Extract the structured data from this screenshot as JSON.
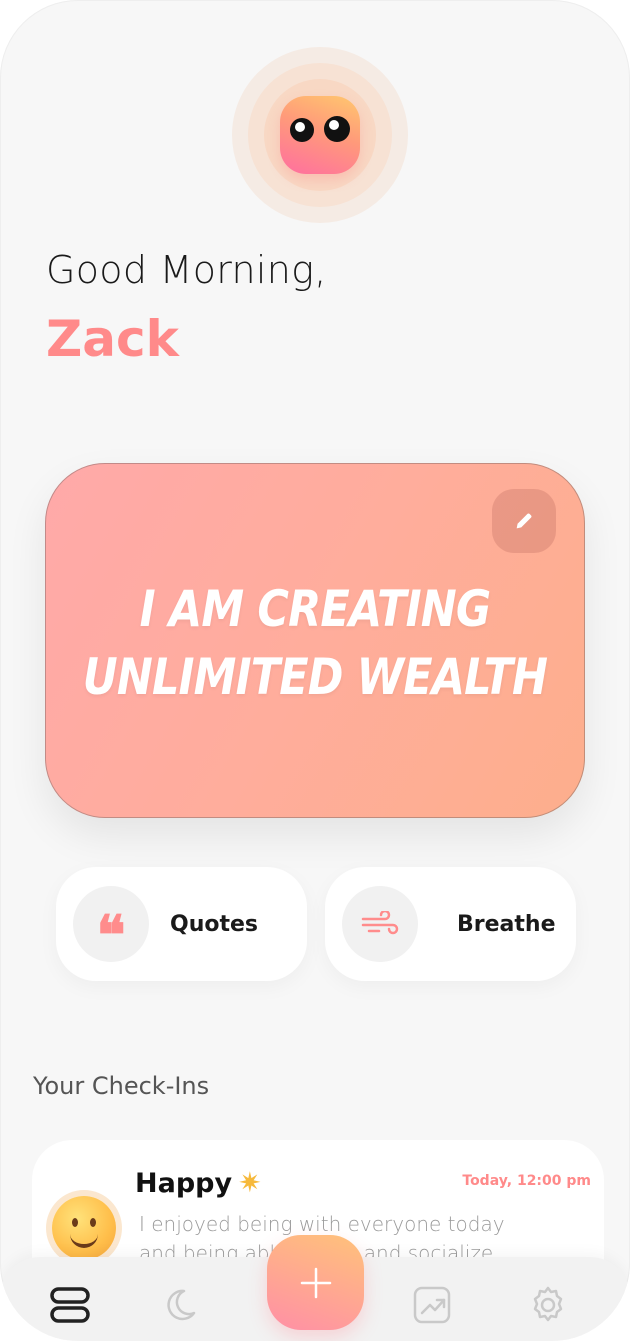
{
  "greeting": {
    "line1": "Good Morning,",
    "name": "Zack"
  },
  "affirmation": {
    "line1": "I AM CREATING",
    "line2": "UNLIMITED WEALTH",
    "edit_icon": "pencil-icon"
  },
  "quick_actions": [
    {
      "label": "Quotes",
      "icon": "quote-icon"
    },
    {
      "label": "Breathe",
      "icon": "wind-icon"
    }
  ],
  "checkins": {
    "title": "Your Check-Ins",
    "items": [
      {
        "mood": "Happy",
        "emoji": "smiling-face-icon",
        "badge": "star-icon",
        "time": "Today, 12:00 pm",
        "note": "I enjoyed being with everyone today and being able to talk and socialize"
      }
    ]
  },
  "nav": [
    "home-icon",
    "moon-icon",
    "add-icon",
    "chart-icon",
    "settings-icon"
  ],
  "colors": {
    "accent": "#ff8a8a",
    "background": "#f7f7f7",
    "card_gradient_start": "#ffa9a9",
    "card_gradient_end": "#fdae8c"
  }
}
